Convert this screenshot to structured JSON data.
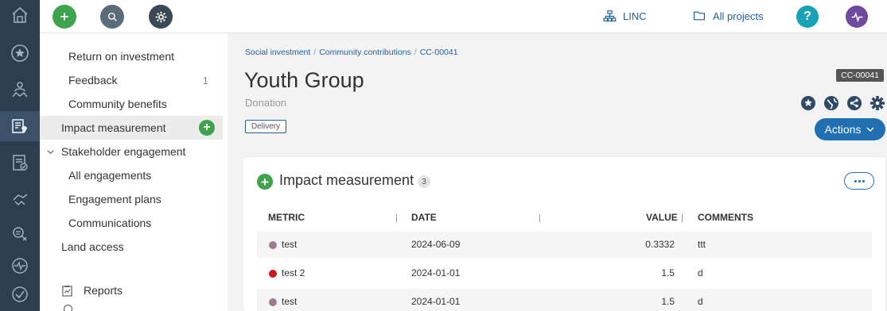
{
  "topbar": {
    "linc_label": "LINC",
    "projects_label": "All projects",
    "help_label": "?"
  },
  "subnav": {
    "items": [
      {
        "label": "Return on investment"
      },
      {
        "label": "Feedback",
        "count": "1"
      },
      {
        "label": "Community benefits"
      },
      {
        "label": "Impact measurement"
      },
      {
        "label": "Stakeholder engagement"
      },
      {
        "label": "All engagements"
      },
      {
        "label": "Engagement plans"
      },
      {
        "label": "Communications"
      },
      {
        "label": "Land access"
      },
      {
        "label": "Reports"
      }
    ]
  },
  "breadcrumb": {
    "items": [
      "Social investment",
      "Community contributions",
      "CC-00041"
    ],
    "separator": "/"
  },
  "record": {
    "title": "Youth Group",
    "type": "Donation",
    "tag": "Delivery",
    "id": "CC-00041",
    "actions_label": "Actions"
  },
  "impact": {
    "title": "Impact measurement",
    "count": "3",
    "columns": {
      "metric": "METRIC",
      "date": "DATE",
      "value": "VALUE",
      "comments": "COMMENTS"
    },
    "rows": [
      {
        "metric": "test",
        "date": "2024-06-09",
        "value": "0.3332",
        "comments": "ttt",
        "color": "#9a7c95"
      },
      {
        "metric": "test 2",
        "date": "2024-01-01",
        "value": "1.5",
        "comments": "d",
        "color": "#d0161b"
      },
      {
        "metric": "test",
        "date": "2024-01-01",
        "value": "1.5",
        "comments": "d",
        "color": "#9a7c95"
      }
    ]
  },
  "colors": {
    "rail": "#2d3e50",
    "accent": "#1f6fb2",
    "add_green": "#3fa34d",
    "help_teal": "#17a2b8",
    "pulse_purple": "#6f4a9e"
  }
}
